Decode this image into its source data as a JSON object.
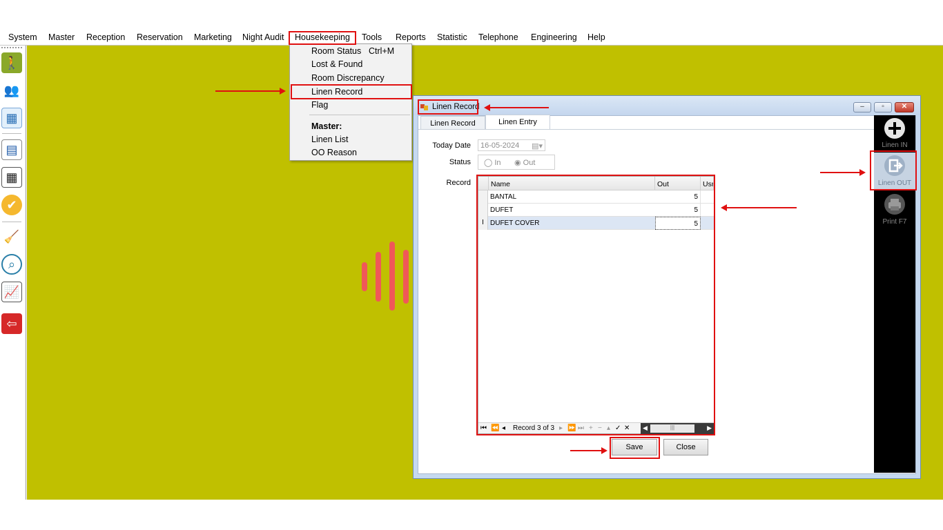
{
  "menubar": {
    "items": [
      "System",
      "Master",
      "Reception",
      "Reservation",
      "Marketing",
      "Night Audit",
      "Housekeeping",
      "Tools",
      "Reports",
      "Statistic",
      "Telephone",
      "Engineering",
      "Help"
    ]
  },
  "housekeeping_menu": {
    "room_status": "Room Status",
    "room_status_shortcut": "Ctrl+M",
    "lost_found": "Lost & Found",
    "room_discrepancy": "Room Discrepancy",
    "linen_record": "Linen Record",
    "flag": "Flag",
    "master_header": "Master:",
    "linen_list": "Linen List",
    "oo_reason": "OO Reason"
  },
  "toolbar": {
    "icons": [
      "walk-icon",
      "guests-icon",
      "floor-plan-icon",
      "calendar-grid-icon",
      "year-calendar-icon",
      "badge-check-icon",
      "housekeeping-icon",
      "analysis-icon",
      "report-chart-icon",
      "exit-icon"
    ]
  },
  "window": {
    "title": "Linen Record",
    "tabs": [
      "Linen Record",
      "Linen Entry"
    ],
    "active_tab": "Linen Entry",
    "today_date_label": "Today Date",
    "today_date_value": "16-05-2024",
    "status_label": "Status",
    "status_in": "In",
    "status_out": "Out",
    "status_selected": "Out",
    "record_label": "Record",
    "grid": {
      "columns": [
        "Name",
        "Out",
        "Usr"
      ],
      "rows": [
        {
          "name": "BANTAL",
          "out": "5"
        },
        {
          "name": "DUFET",
          "out": "5"
        },
        {
          "name": "DUFET COVER",
          "out": "5"
        }
      ],
      "row_indicator": "I",
      "navigator_text": "Record 3 of 3"
    },
    "save_label": "Save",
    "close_label": "Close",
    "window_buttons": {
      "minimize": "–",
      "restore": "▫",
      "close": "✕"
    }
  },
  "side_panel": {
    "linen_in": "Linen IN",
    "linen_out": "Linen OUT",
    "print": "Print F7"
  },
  "colors": {
    "workspace": "#c0c000",
    "highlight": "#e01010",
    "wave": "#f05858"
  }
}
